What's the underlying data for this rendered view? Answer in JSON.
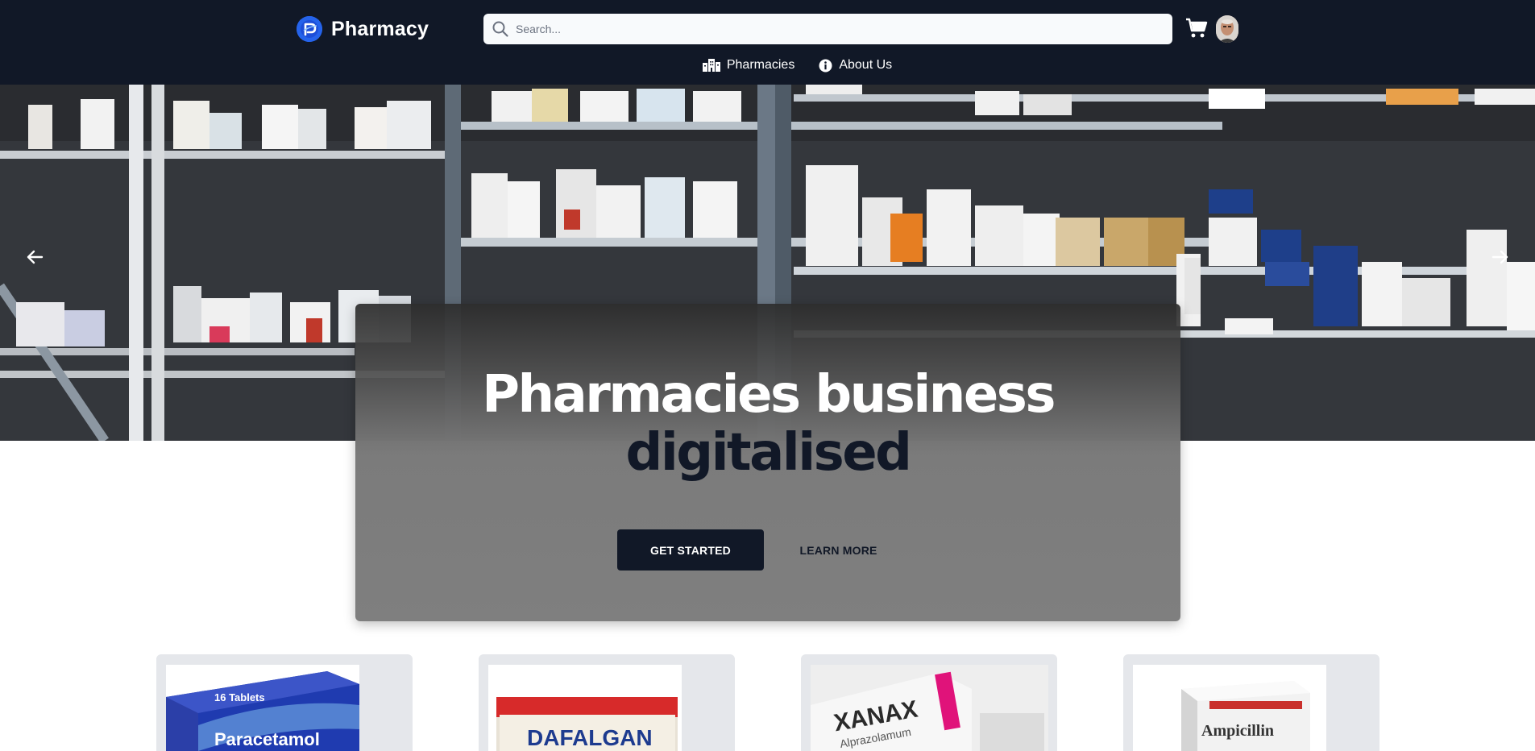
{
  "brand": {
    "name": "Pharmacy",
    "logo_icon": "pharmacy-logo-icon",
    "accent": "#2563eb"
  },
  "search": {
    "placeholder": "Search...",
    "value": ""
  },
  "nav": {
    "cart_icon": "cart-icon",
    "avatar": "user-avatar",
    "links": [
      {
        "label": "Pharmacies",
        "icon": "buildings-icon"
      },
      {
        "label": "About Us",
        "icon": "info-icon"
      }
    ]
  },
  "hero": {
    "title_line1": "Pharmacies business",
    "title_line2": "digitalised",
    "primary_button": "GET STARTED",
    "secondary_button": "LEARN MORE",
    "prev_icon": "arrow-left-icon",
    "next_icon": "arrow-right-icon"
  },
  "products": [
    {
      "name": "Paracetamol",
      "box_text": "Paracetamol",
      "badge": "16 Tablets"
    },
    {
      "name": "Dafalgan",
      "box_text": "DAFALGAN"
    },
    {
      "name": "Xanax",
      "box_text": "XANAX",
      "subtext": "Alprazolamum"
    },
    {
      "name": "Ampicillin",
      "box_text": "Ampicillin"
    }
  ],
  "colors": {
    "navbar": "#111827",
    "primary_button": "#111827",
    "card": "#e5e7eb"
  }
}
